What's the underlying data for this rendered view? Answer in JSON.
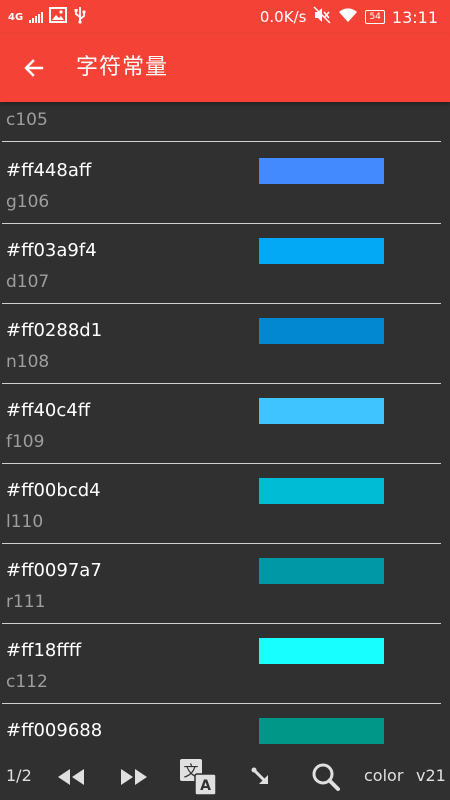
{
  "statusbar": {
    "network": "4G",
    "speed": "0.0K/s",
    "battery": "54",
    "time": "13:11"
  },
  "appbar": {
    "title": "字符常量",
    "back_icon": "arrow-left-icon"
  },
  "colors": {
    "primary": "#f44336",
    "background": "#303030",
    "divider": "#cfcfcf"
  },
  "items": [
    {
      "hex": "",
      "name": "c105",
      "color": "#3f51b5"
    },
    {
      "hex": "#ff448aff",
      "name": "g106",
      "color": "#448aff"
    },
    {
      "hex": "#ff03a9f4",
      "name": "d107",
      "color": "#03a9f4"
    },
    {
      "hex": "#ff0288d1",
      "name": "n108",
      "color": "#0288d1"
    },
    {
      "hex": "#ff40c4ff",
      "name": "f109",
      "color": "#40c4ff"
    },
    {
      "hex": "#ff00bcd4",
      "name": "l110",
      "color": "#00bcd4"
    },
    {
      "hex": "#ff0097a7",
      "name": "r111",
      "color": "#0097a7"
    },
    {
      "hex": "#ff18ffff",
      "name": "c112",
      "color": "#18ffff"
    },
    {
      "hex": "#ff009688",
      "name": "",
      "color": "#009688"
    }
  ],
  "bottombar": {
    "page": "1/2",
    "prev_icon": "rewind-icon",
    "next_icon": "fast-forward-icon",
    "translate_icon": "translate-icon",
    "jump_icon": "arrow-down-right-icon",
    "search_icon": "search-icon",
    "type_label": "color",
    "version": "v21"
  }
}
